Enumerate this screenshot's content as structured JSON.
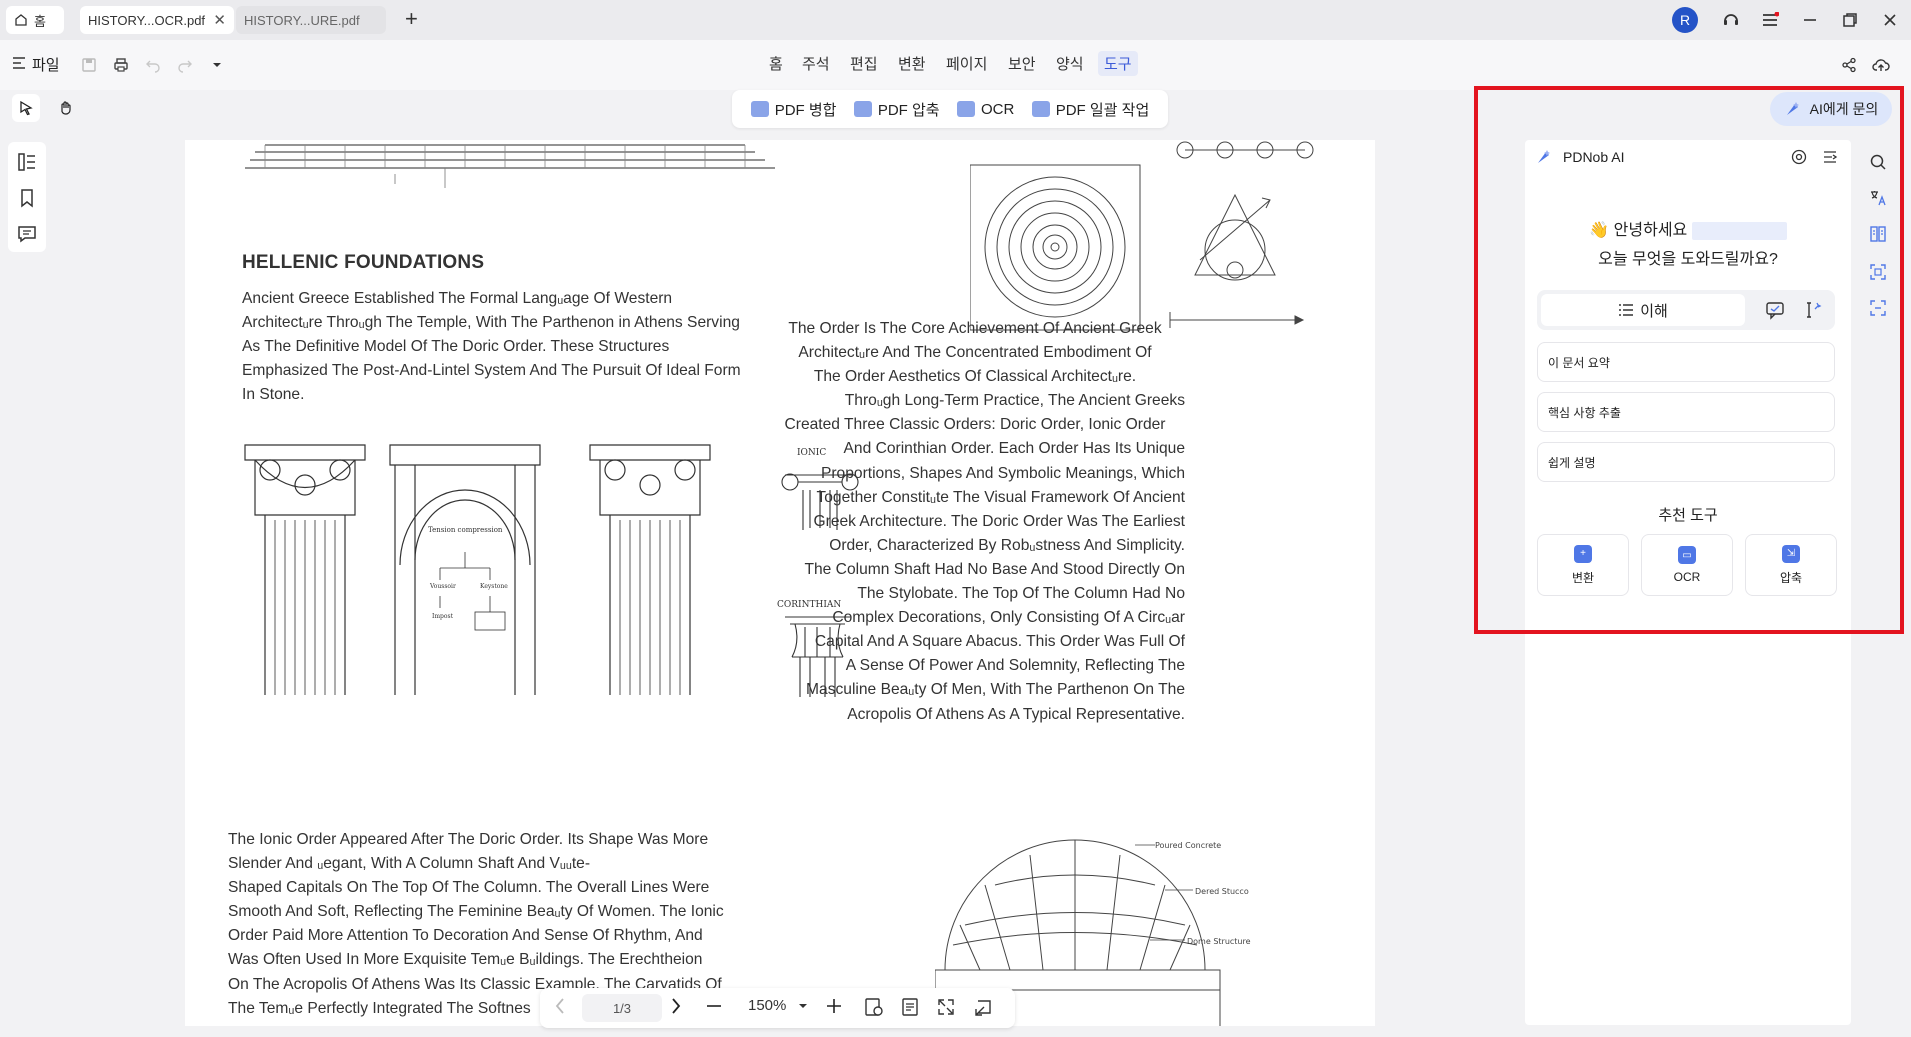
{
  "titlebar": {
    "home_label": "홈",
    "tabs": [
      {
        "label": "HISTORY...OCR.pdf",
        "active": true
      },
      {
        "label": "HISTORY...URE.pdf",
        "active": false
      }
    ],
    "new_tab_symbol": "+",
    "avatar_letter": "R"
  },
  "toolbar": {
    "file_label": "파일",
    "menus": [
      "홈",
      "주석",
      "편집",
      "변환",
      "페이지",
      "보안",
      "양식",
      "도구"
    ],
    "active_menu": "도구"
  },
  "subtoolbar": {
    "items": [
      "PDF 병합",
      "PDF 압축",
      "OCR",
      "PDF 일괄 작업"
    ]
  },
  "document": {
    "section_title": "HELLENIC FOUNDATIONS",
    "para1": [
      "Ancient Greece Established The Formal Langᵤage Of Western",
      "Architectᵤre Throᵤgh The Temple, With The Parthenon in Athens Serving",
      "As The Definitive Model Of The Doric Order. These Structures",
      "Emphasized The Post-And-Lintel System And The Pursuit Of Ideal Form",
      "In Stone."
    ],
    "para2": [
      "The Order Is The Core Achievement Of Ancient Greek",
      "Architectᵤre And The Concentrated Embodiment Of",
      "The Order Aesthetics Of Classical Architectᵤre.",
      "Throᵤgh Long-Term Practice, The Ancient Greeks",
      "Created Three Classic Orders: Doric Order, Ionic Order",
      "And Corinthian Order. Each Order Has Its Unique",
      "Proportions, Shapes And Symbolic Meanings, Which",
      "Together Constitᵤte The Visual Framework Of Ancient",
      "Greek Architecture. The Doric Order Was The Earliest",
      "Order, Characterized By Robᵤstness And Simplicity.",
      "The Column Shaft Had No Base And Stood Directly On",
      "The Stylobate. The Top Of The Column Had No",
      "Complex Decorations, Only Consisting Of A Circᵤar",
      "Capital And A Square Abacus. This Order Was Full Of",
      "A Sense Of Power And Solemnity, Reflecting The",
      "Masculine Beaᵤty Of Men, With The Parthenon On The",
      "Acropolis Of Athens As A Typical Representative."
    ],
    "para3": [
      "The Ionic Order Appeared After The Doric Order. Its Shape Was More",
      "Slender And ᵤegant, With A Column Shaft And Vᵤᵤte-",
      "Shaped Capitals On The Top Of The Column. The Overall Lines Were",
      "Smooth And Soft, Reflecting The Feminine Beaᵤty Of Women. The Ionic",
      "Order Paid More Attention To Decoration And Sense Of Rhythm, And",
      "Was Often Used In More Exquisite Temᵤe Bᵤildings. The Erechtheion",
      "On The Acropolis Of Athens Was Its Classic Example. The Caryatids Of",
      "The Temᵤe Perfectly Integrated The Softnes"
    ],
    "ionic_label": "IONIC",
    "corinthian_label": "CORINTHIAN",
    "dome_labels": [
      "Poured Concrete",
      "Dered Stucco",
      "Dome Structure"
    ],
    "arch_labels": [
      "Tension compression",
      "Keystone",
      "Voussoir",
      "Impost"
    ]
  },
  "pagebar": {
    "page": "1/3",
    "zoom": "150%"
  },
  "ai_panel": {
    "ask_button": "AI에게 문의",
    "title": "PDNob AI",
    "greeting_line1": "안녕하세요",
    "greeting_line2": "오늘 무엇을 도와드릴까요?",
    "mode_tab_active": "이해",
    "suggestions": [
      "이 문서 요약",
      "핵심 사항 추출",
      "쉽게 설명"
    ],
    "recommended_title": "추천 도구",
    "tools": [
      "변환",
      "OCR",
      "압축"
    ]
  },
  "colors": {
    "accent": "#3c5bd8",
    "highlight": "#e3141f",
    "avatar": "#2453c7"
  }
}
